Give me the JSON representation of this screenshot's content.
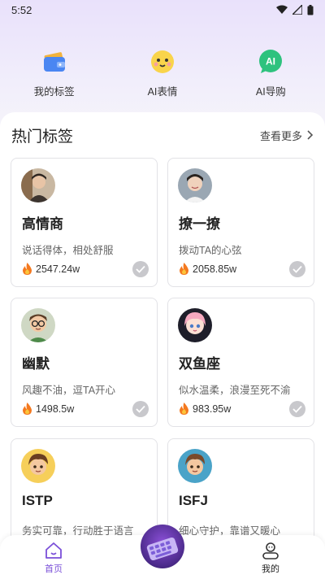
{
  "status_bar": {
    "time": "5:52"
  },
  "quick_actions": [
    {
      "label": "我的标签",
      "icon": "wallet-icon"
    },
    {
      "label": "AI表情",
      "icon": "emoji-face-icon"
    },
    {
      "label": "AI导购",
      "icon": "ai-bubble-icon"
    }
  ],
  "section": {
    "title": "热门标签",
    "more_label": "查看更多"
  },
  "cards": [
    {
      "title": "高情商",
      "desc": "说话得体，相处舒服",
      "heat": "2547.24w",
      "avatar": "avatar-man-brown"
    },
    {
      "title": "撩一撩",
      "desc": "拨动TA的心弦",
      "heat": "2058.85w",
      "avatar": "avatar-man-smile"
    },
    {
      "title": "幽默",
      "desc": "风趣不油，逗TA开心",
      "heat": "1498.5w",
      "avatar": "avatar-cartoon-glasses"
    },
    {
      "title": "双鱼座",
      "desc": "似水温柔，浪漫至死不渝",
      "heat": "983.95w",
      "avatar": "avatar-pink-hair"
    },
    {
      "title": "ISTP",
      "desc": "务实可靠，行动胜于语言",
      "heat": "",
      "avatar": "avatar-cartoon-boy"
    },
    {
      "title": "ISFJ",
      "desc": "细心守护，靠谱又暖心",
      "heat": "",
      "avatar": "avatar-cartoon-boy-blue"
    }
  ],
  "bottom_nav": {
    "home_label": "首页",
    "me_label": "我的"
  },
  "colors": {
    "accent": "#7a4fd8",
    "card_border": "#e2e2e6",
    "flame": "#f4791f"
  }
}
